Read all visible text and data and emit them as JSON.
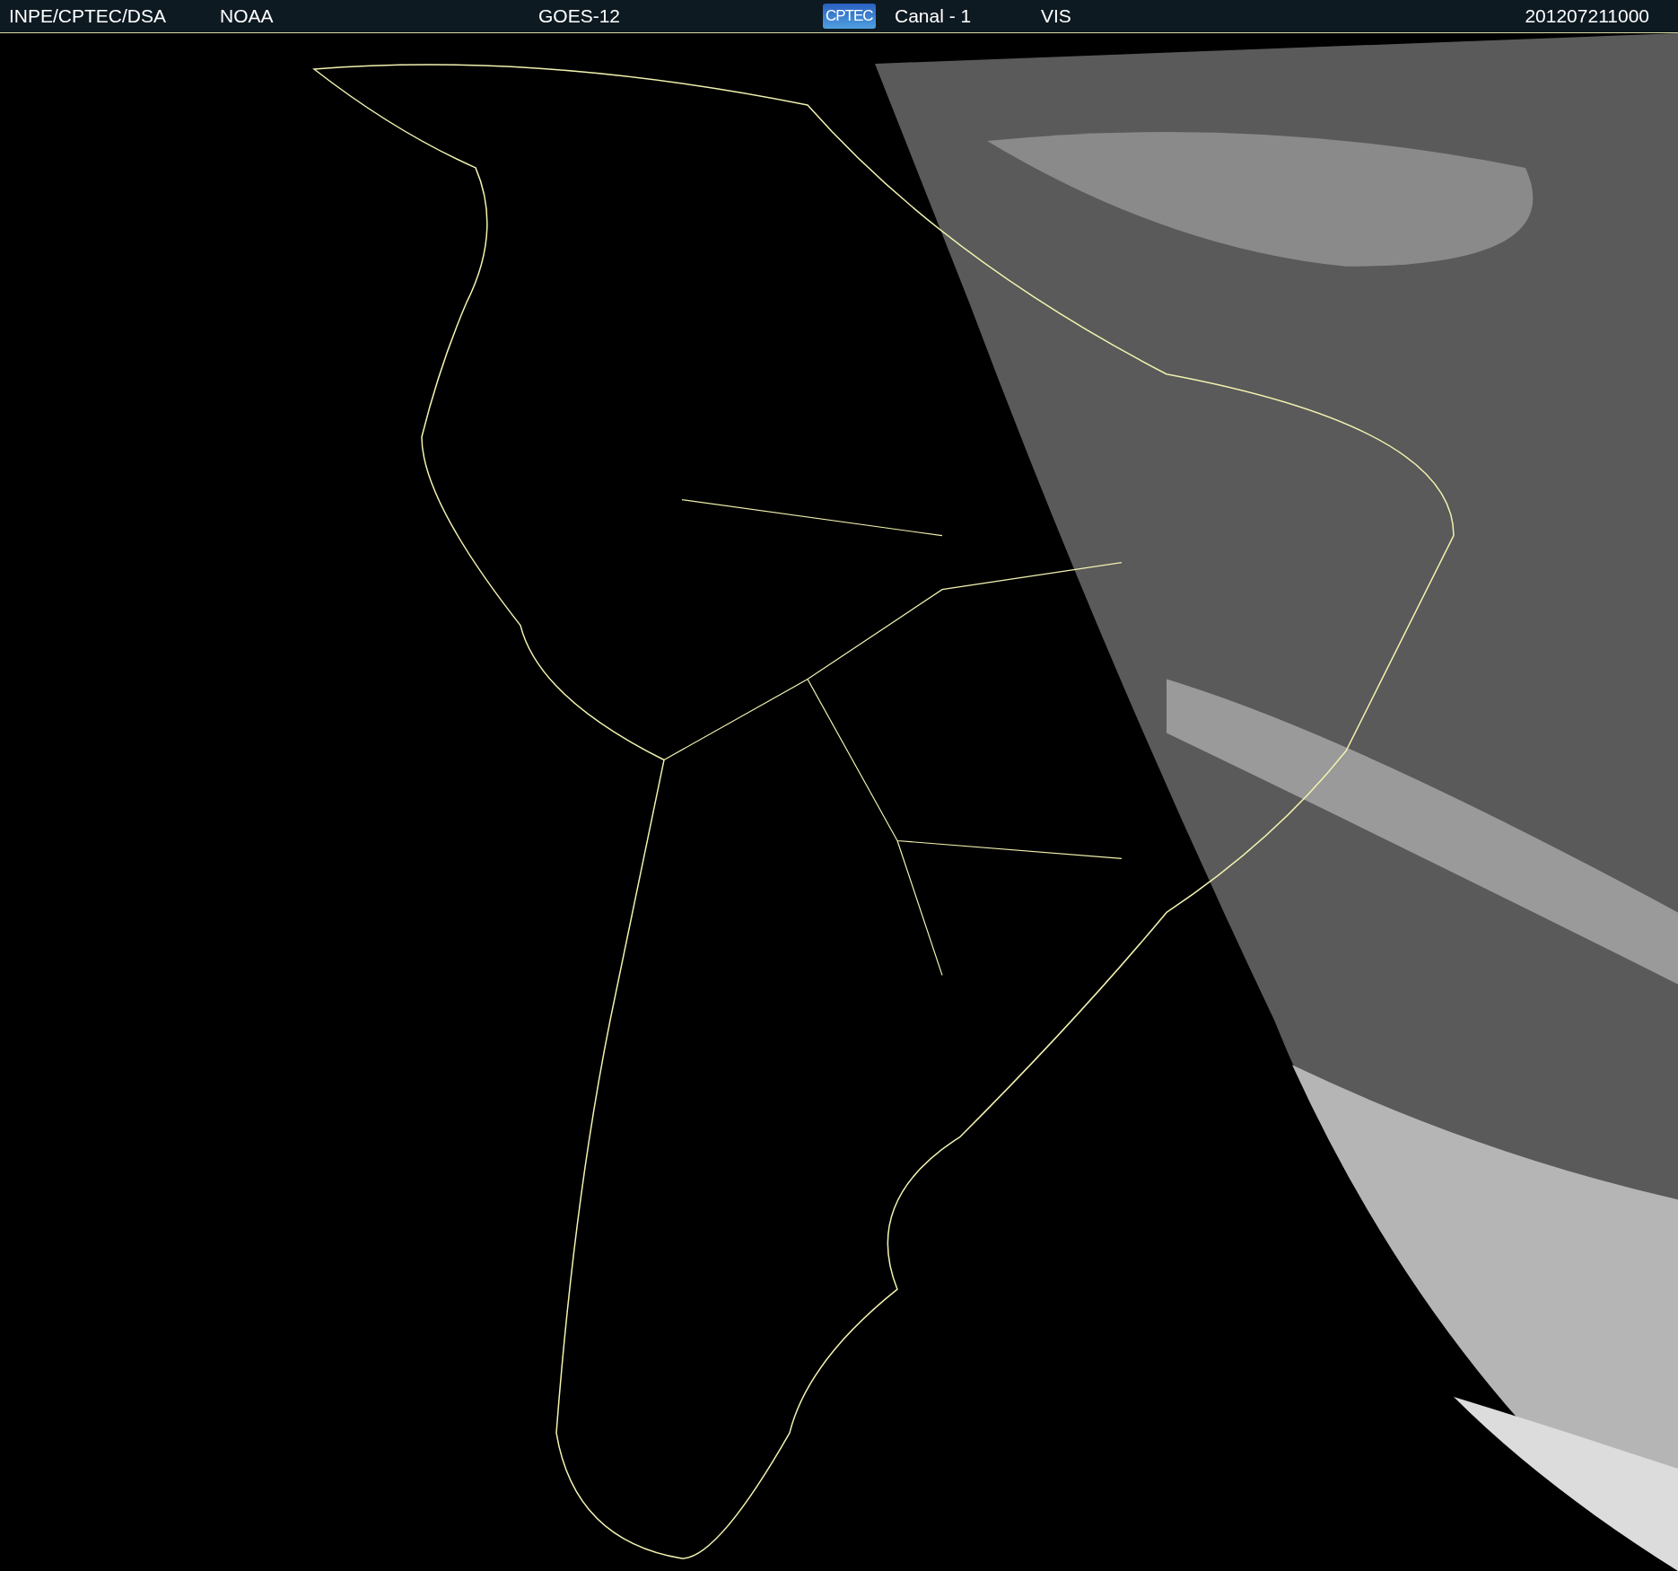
{
  "header": {
    "items": [
      {
        "kind": "text",
        "text": "INPE/CPTEC/DSA"
      },
      {
        "kind": "text",
        "text": "NOAA"
      },
      {
        "kind": "text",
        "text": "GOES-12"
      },
      {
        "kind": "logo",
        "text": "CPTEC"
      },
      {
        "kind": "text",
        "text": "Canal - 1"
      },
      {
        "kind": "text",
        "text": "VIS"
      },
      {
        "kind": "text",
        "text": "201207211000"
      }
    ]
  }
}
